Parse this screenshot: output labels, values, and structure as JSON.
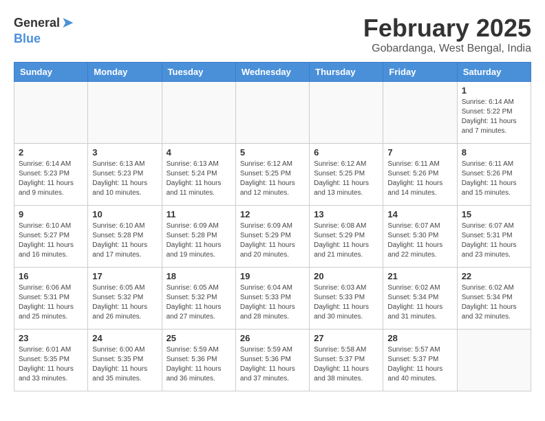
{
  "logo": {
    "general": "General",
    "blue": "Blue"
  },
  "title": "February 2025",
  "subtitle": "Gobardanga, West Bengal, India",
  "days_of_week": [
    "Sunday",
    "Monday",
    "Tuesday",
    "Wednesday",
    "Thursday",
    "Friday",
    "Saturday"
  ],
  "weeks": [
    [
      {
        "day": "",
        "info": ""
      },
      {
        "day": "",
        "info": ""
      },
      {
        "day": "",
        "info": ""
      },
      {
        "day": "",
        "info": ""
      },
      {
        "day": "",
        "info": ""
      },
      {
        "day": "",
        "info": ""
      },
      {
        "day": "1",
        "info": "Sunrise: 6:14 AM\nSunset: 5:22 PM\nDaylight: 11 hours\nand 7 minutes."
      }
    ],
    [
      {
        "day": "2",
        "info": "Sunrise: 6:14 AM\nSunset: 5:23 PM\nDaylight: 11 hours\nand 9 minutes."
      },
      {
        "day": "3",
        "info": "Sunrise: 6:13 AM\nSunset: 5:23 PM\nDaylight: 11 hours\nand 10 minutes."
      },
      {
        "day": "4",
        "info": "Sunrise: 6:13 AM\nSunset: 5:24 PM\nDaylight: 11 hours\nand 11 minutes."
      },
      {
        "day": "5",
        "info": "Sunrise: 6:12 AM\nSunset: 5:25 PM\nDaylight: 11 hours\nand 12 minutes."
      },
      {
        "day": "6",
        "info": "Sunrise: 6:12 AM\nSunset: 5:25 PM\nDaylight: 11 hours\nand 13 minutes."
      },
      {
        "day": "7",
        "info": "Sunrise: 6:11 AM\nSunset: 5:26 PM\nDaylight: 11 hours\nand 14 minutes."
      },
      {
        "day": "8",
        "info": "Sunrise: 6:11 AM\nSunset: 5:26 PM\nDaylight: 11 hours\nand 15 minutes."
      }
    ],
    [
      {
        "day": "9",
        "info": "Sunrise: 6:10 AM\nSunset: 5:27 PM\nDaylight: 11 hours\nand 16 minutes."
      },
      {
        "day": "10",
        "info": "Sunrise: 6:10 AM\nSunset: 5:28 PM\nDaylight: 11 hours\nand 17 minutes."
      },
      {
        "day": "11",
        "info": "Sunrise: 6:09 AM\nSunset: 5:28 PM\nDaylight: 11 hours\nand 19 minutes."
      },
      {
        "day": "12",
        "info": "Sunrise: 6:09 AM\nSunset: 5:29 PM\nDaylight: 11 hours\nand 20 minutes."
      },
      {
        "day": "13",
        "info": "Sunrise: 6:08 AM\nSunset: 5:29 PM\nDaylight: 11 hours\nand 21 minutes."
      },
      {
        "day": "14",
        "info": "Sunrise: 6:07 AM\nSunset: 5:30 PM\nDaylight: 11 hours\nand 22 minutes."
      },
      {
        "day": "15",
        "info": "Sunrise: 6:07 AM\nSunset: 5:31 PM\nDaylight: 11 hours\nand 23 minutes."
      }
    ],
    [
      {
        "day": "16",
        "info": "Sunrise: 6:06 AM\nSunset: 5:31 PM\nDaylight: 11 hours\nand 25 minutes."
      },
      {
        "day": "17",
        "info": "Sunrise: 6:05 AM\nSunset: 5:32 PM\nDaylight: 11 hours\nand 26 minutes."
      },
      {
        "day": "18",
        "info": "Sunrise: 6:05 AM\nSunset: 5:32 PM\nDaylight: 11 hours\nand 27 minutes."
      },
      {
        "day": "19",
        "info": "Sunrise: 6:04 AM\nSunset: 5:33 PM\nDaylight: 11 hours\nand 28 minutes."
      },
      {
        "day": "20",
        "info": "Sunrise: 6:03 AM\nSunset: 5:33 PM\nDaylight: 11 hours\nand 30 minutes."
      },
      {
        "day": "21",
        "info": "Sunrise: 6:02 AM\nSunset: 5:34 PM\nDaylight: 11 hours\nand 31 minutes."
      },
      {
        "day": "22",
        "info": "Sunrise: 6:02 AM\nSunset: 5:34 PM\nDaylight: 11 hours\nand 32 minutes."
      }
    ],
    [
      {
        "day": "23",
        "info": "Sunrise: 6:01 AM\nSunset: 5:35 PM\nDaylight: 11 hours\nand 33 minutes."
      },
      {
        "day": "24",
        "info": "Sunrise: 6:00 AM\nSunset: 5:35 PM\nDaylight: 11 hours\nand 35 minutes."
      },
      {
        "day": "25",
        "info": "Sunrise: 5:59 AM\nSunset: 5:36 PM\nDaylight: 11 hours\nand 36 minutes."
      },
      {
        "day": "26",
        "info": "Sunrise: 5:59 AM\nSunset: 5:36 PM\nDaylight: 11 hours\nand 37 minutes."
      },
      {
        "day": "27",
        "info": "Sunrise: 5:58 AM\nSunset: 5:37 PM\nDaylight: 11 hours\nand 38 minutes."
      },
      {
        "day": "28",
        "info": "Sunrise: 5:57 AM\nSunset: 5:37 PM\nDaylight: 11 hours\nand 40 minutes."
      },
      {
        "day": "",
        "info": ""
      }
    ]
  ]
}
